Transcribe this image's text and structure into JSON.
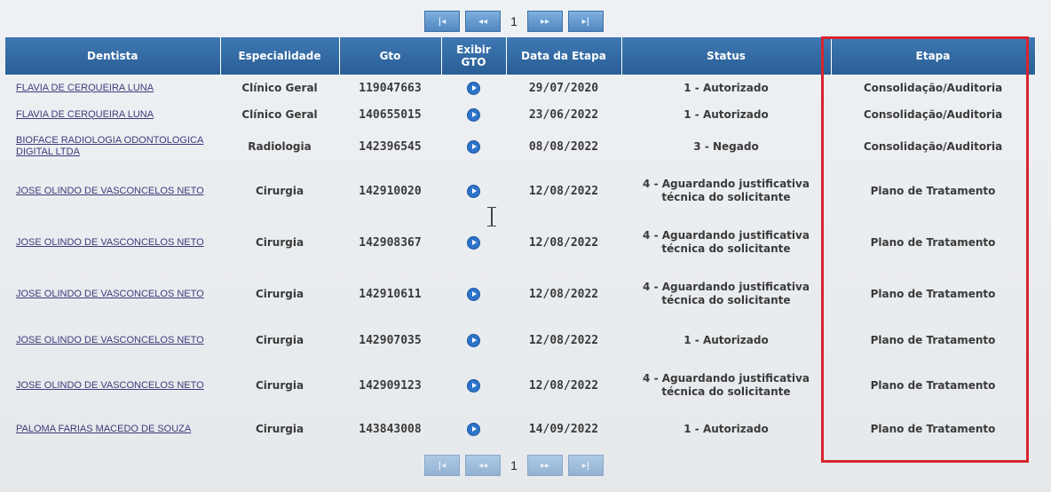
{
  "pager": {
    "first_label": "|◂",
    "prev_label": "◂◂",
    "current_page": "1",
    "next_label": "▸▸",
    "last_label": "▸|"
  },
  "columns": [
    "Dentista",
    "Especialidade",
    "Gto",
    "Exibir GTO",
    "Data da Etapa",
    "Status",
    "Etapa"
  ],
  "rows": [
    {
      "dentist": "FLAVIA DE CERQUEIRA LUNA",
      "spec": "Clínico Geral",
      "gto": "119047663",
      "date": "29/07/2020",
      "status": "1 - Autorizado",
      "etapa": "Consolidação/Auditoria"
    },
    {
      "dentist": "FLAVIA DE CERQUEIRA LUNA",
      "spec": "Clínico Geral",
      "gto": "140655015",
      "date": "23/06/2022",
      "status": "1 - Autorizado",
      "etapa": "Consolidação/Auditoria"
    },
    {
      "dentist": "BIOFACE RADIOLOGIA ODONTOLOGICA DIGITAL LTDA",
      "spec": "Radiologia",
      "gto": "142396545",
      "date": "08/08/2022",
      "status": "3 - Negado",
      "etapa": "Consolidação/Auditoria"
    },
    {
      "dentist": "JOSE OLINDO DE VASCONCELOS NETO",
      "spec": "Cirurgia",
      "gto": "142910020",
      "date": "12/08/2022",
      "status": "4 - Aguardando justificativa técnica do solicitante",
      "etapa": "Plano de Tratamento"
    },
    {
      "dentist": "JOSE OLINDO DE VASCONCELOS NETO",
      "spec": "Cirurgia",
      "gto": "142908367",
      "date": "12/08/2022",
      "status": "4 - Aguardando justificativa técnica do solicitante",
      "etapa": "Plano de Tratamento"
    },
    {
      "dentist": "JOSE OLINDO DE VASCONCELOS NETO",
      "spec": "Cirurgia",
      "gto": "142910611",
      "date": "12/08/2022",
      "status": "4 - Aguardando justificativa técnica do solicitante",
      "etapa": "Plano de Tratamento"
    },
    {
      "dentist": "JOSE OLINDO DE VASCONCELOS NETO",
      "spec": "Cirurgia",
      "gto": "142907035",
      "date": "12/08/2022",
      "status": "1 - Autorizado",
      "etapa": "Plano de Tratamento"
    },
    {
      "dentist": "JOSE OLINDO DE VASCONCELOS NETO",
      "spec": "Cirurgia",
      "gto": "142909123",
      "date": "12/08/2022",
      "status": "4 - Aguardando justificativa técnica do solicitante",
      "etapa": "Plano de Tratamento"
    },
    {
      "dentist": "PALOMA FARIAS MACEDO DE SOUZA",
      "spec": "Cirurgia",
      "gto": "143843008",
      "date": "14/09/2022",
      "status": "1 - Autorizado",
      "etapa": "Plano de Tratamento"
    }
  ],
  "colors": {
    "header": "#2f6aa5",
    "highlight": "#d6252f",
    "link": "#3c3c7a",
    "icon": "#2d74c9"
  }
}
